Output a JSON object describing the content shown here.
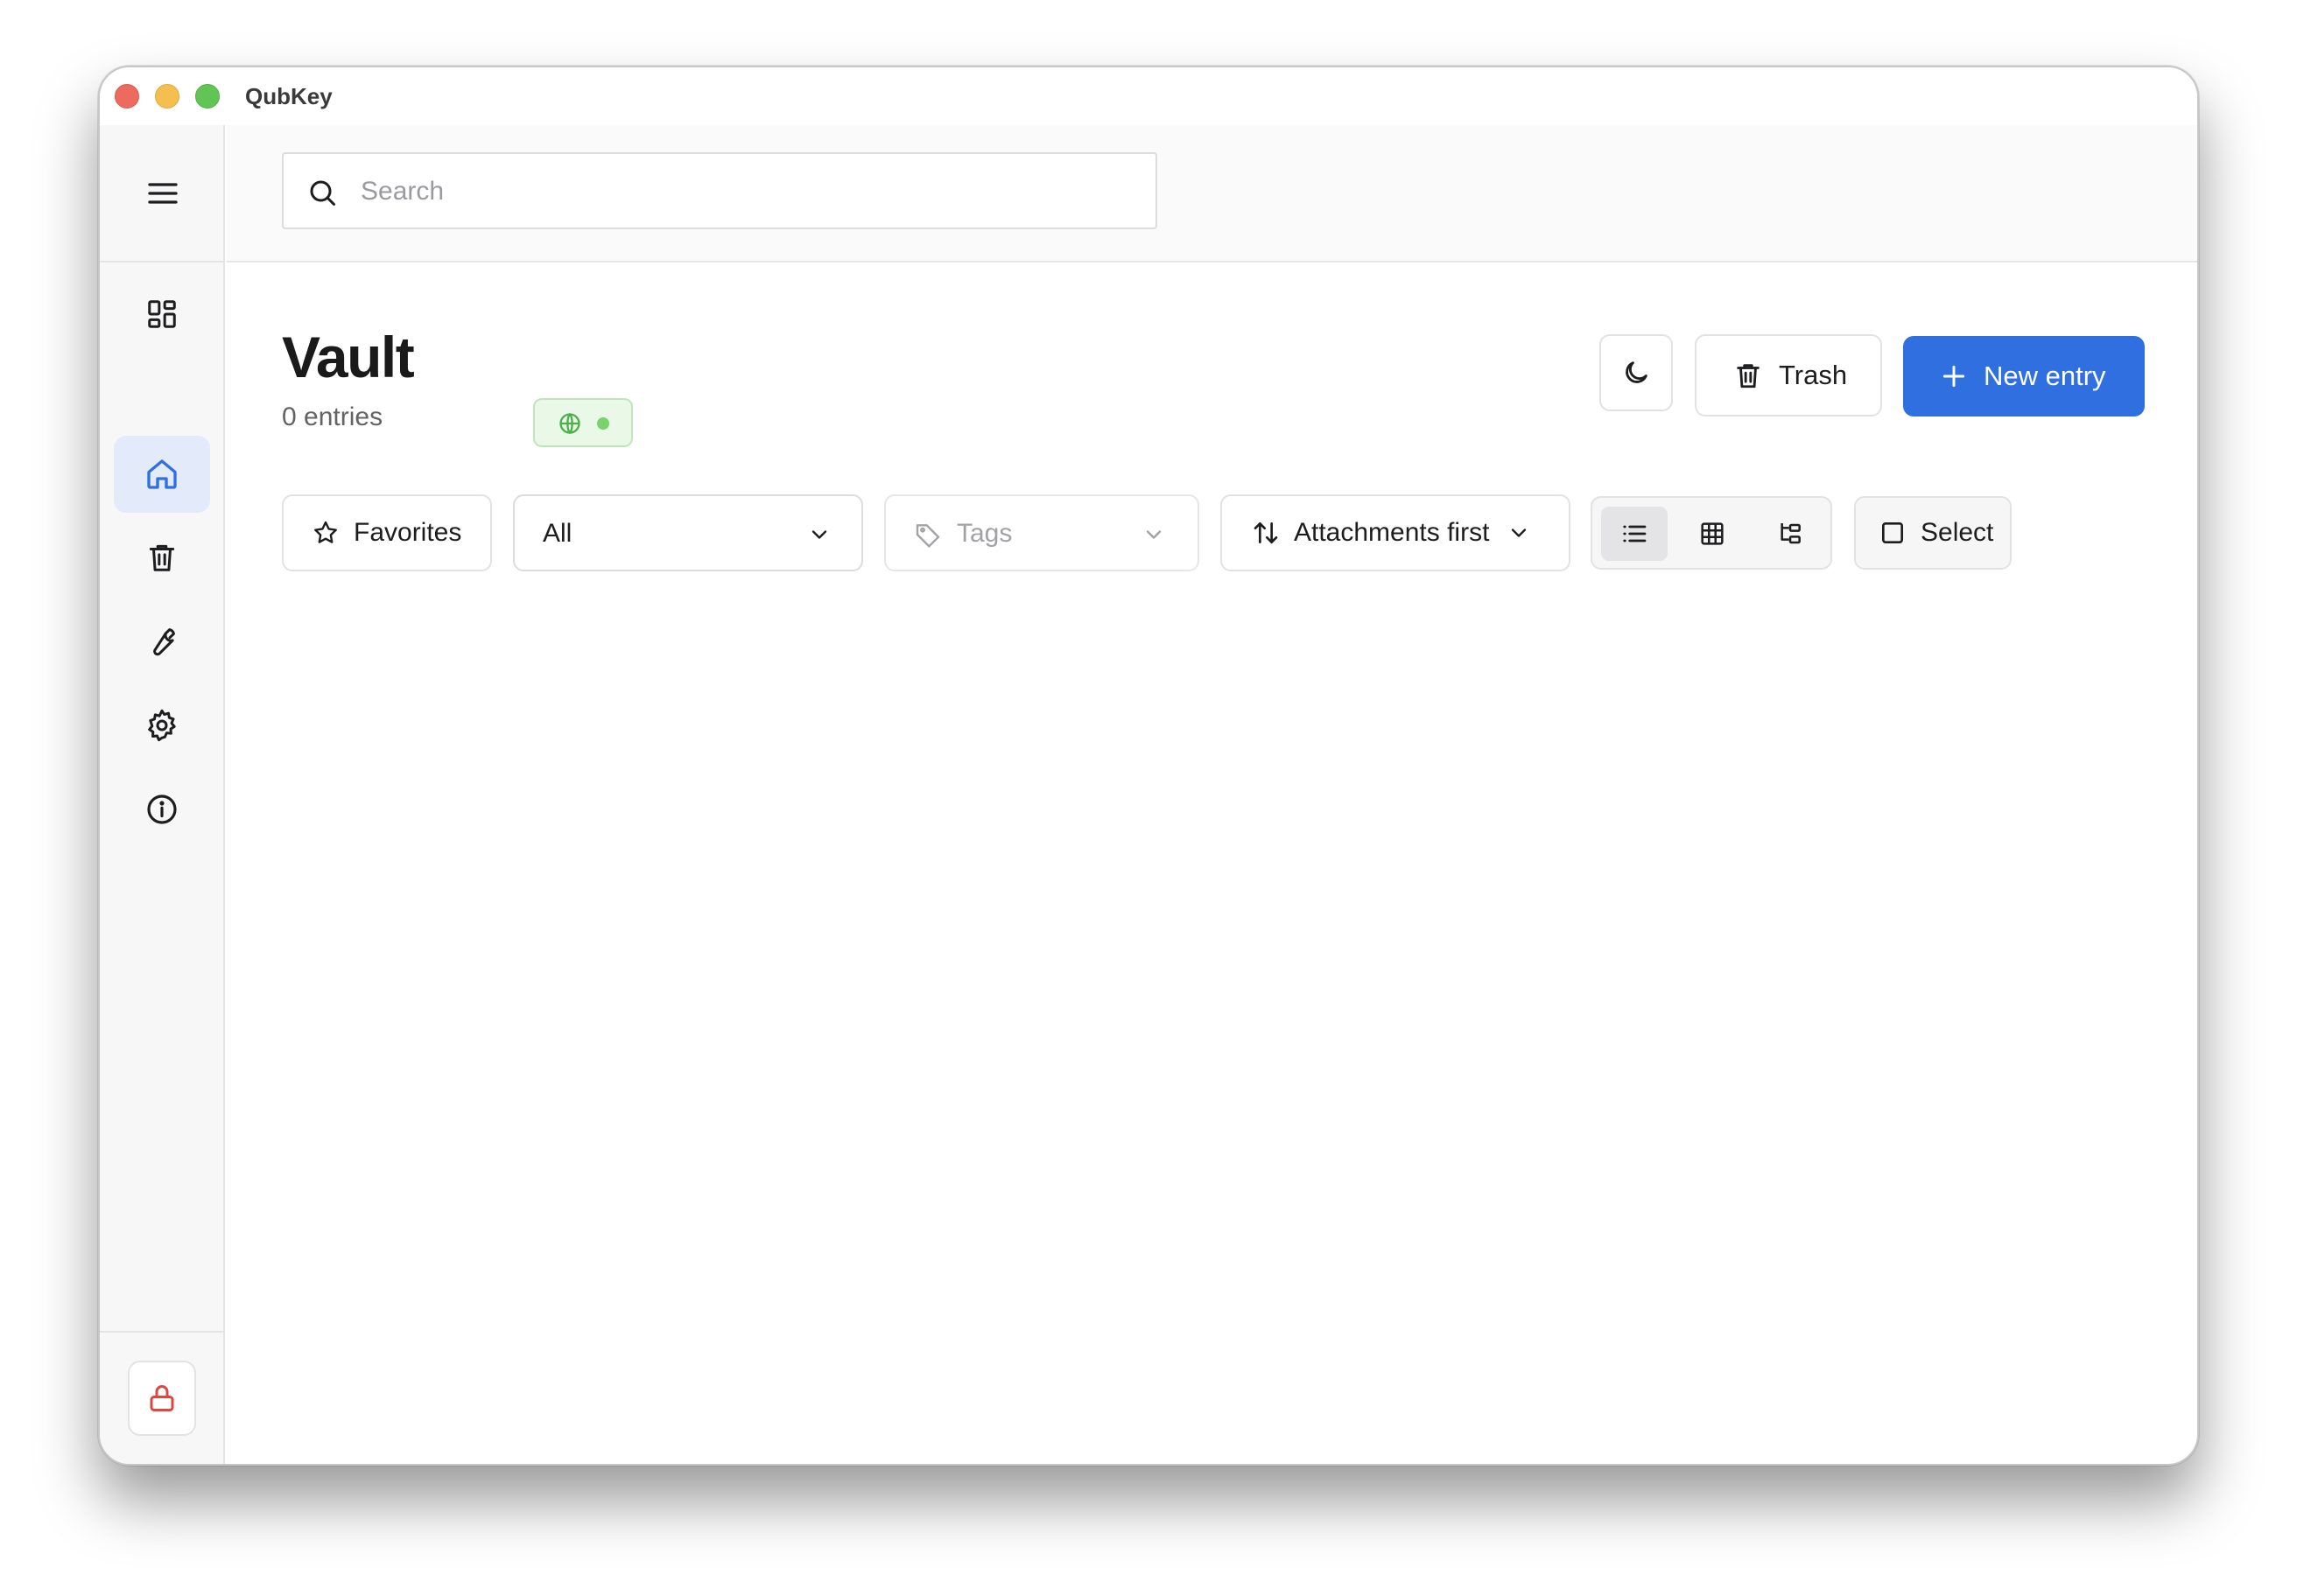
{
  "window": {
    "title": "QubKey"
  },
  "search": {
    "placeholder": "Search"
  },
  "page": {
    "title": "Vault",
    "entry_count": "0 entries"
  },
  "actions": {
    "trash_label": "Trash",
    "new_entry_label": "New entry"
  },
  "filters": {
    "favorites_label": "Favorites",
    "type_selected": "All",
    "tags_placeholder": "Tags",
    "sort_selected": "Attachments first",
    "select_label": "Select"
  },
  "sidebar": {
    "items": [
      {
        "icon": "dashboard-icon"
      },
      {
        "icon": "home-icon",
        "active": true
      },
      {
        "icon": "trash-icon"
      },
      {
        "icon": "wrench-icon"
      },
      {
        "icon": "gear-icon"
      },
      {
        "icon": "info-icon"
      }
    ],
    "bottom": {
      "icon": "lock-icon"
    }
  },
  "colors": {
    "accent": "#2f6fe0",
    "active_nav_bg": "#e3ebfb",
    "status_green": "#79d36d",
    "lock_red": "#e0453f"
  }
}
